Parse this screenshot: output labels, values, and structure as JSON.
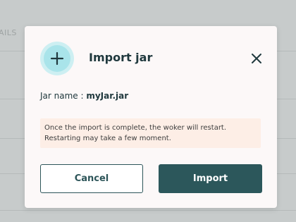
{
  "background": {
    "partial_text": "AILS"
  },
  "dialog": {
    "title": "Import jar",
    "jar_name_label": "Jar name : ",
    "jar_name_value": "myJar.jar",
    "notice_line1": "Once the import is complete, the woker will restart.",
    "notice_line2": "Restarting may take a few moment.",
    "cancel_label": "Cancel",
    "import_label": "Import",
    "header_icon": "plus-icon",
    "close_icon": "close-icon"
  },
  "colors": {
    "primary": "#2c575b",
    "icon_ring_outer": "#cdeff2",
    "icon_ring_inner": "#a9e4ea",
    "notice_bg": "#fdeee6",
    "overlay": "#c7cbcb"
  }
}
